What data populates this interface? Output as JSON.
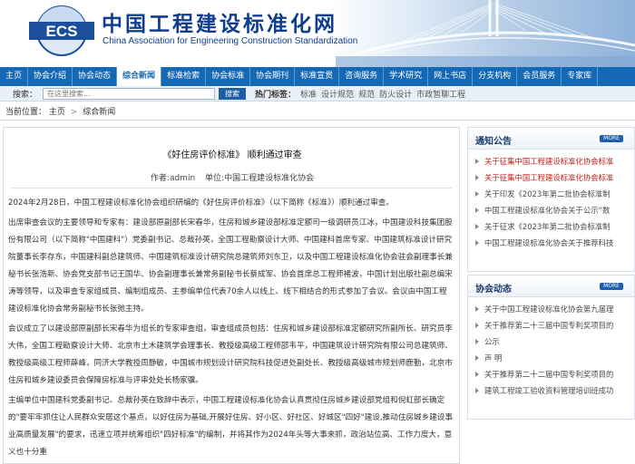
{
  "header": {
    "logo_text": "ECS",
    "title": "中国工程建设标准化网",
    "subtitle": "China Association for Engineering Construction Standardization"
  },
  "nav": {
    "items": [
      "主页",
      "协会介绍",
      "协会动态",
      "综合新闻",
      "标准检索",
      "协会标准",
      "协会期刊",
      "标准宣贯",
      "咨询服务",
      "学术研究",
      "网上书店",
      "分支机构",
      "会员服务",
      "专家库"
    ],
    "active_index": 3
  },
  "search": {
    "label": "搜索：",
    "placeholder": "在这里搜索...",
    "button": "搜索",
    "hot_label": "热门标签：",
    "tags": [
      "标准",
      "设计规范",
      "规范",
      "防火设计",
      "市政暂聊工程"
    ]
  },
  "breadcrumb": {
    "prefix": "当前位置：",
    "items": [
      "主页",
      "综合新闻"
    ],
    "sep": ">"
  },
  "article": {
    "title": "《好住房评价标准》 顺利通过审查",
    "author": "作者:admin",
    "unit": "单位:中国工程建设标准化协会",
    "paragraphs": [
      "2024年2月28日，中国工程建设标准化协会组织研编的《好住房评价标准》（以下简称《标准》）顺利通过审查。",
      "出席审查会议的主要领导和专家有：建设部原副部长宋春华，住房和城乡建设部标准定额司一级调研员江冰，中国建设科技集团股份有限公司（以下简称\"中国建科\"）党委副书记、总裁孙英，全国工程勘察设计大师、中国建科首席专家、中国建筑标准设计研究院董事长李存东，中国建科副总建筑师、中国建筑标准设计研究院总建筑师刘东卫，以及中国工程建设标准化协会驻会副理事长兼秘书长张浩新、协会党支部书记王国华、协会副理事长兼常务副秘书长蔡成军、协会首席总工程师褚波，中国计划出版社副总编宋涛等领导，以及审查专家组成员、编制组成员、主参编单位代表70余人以线上、线下相结合的形式参加了会议。会议由中国工程建设标准化协会常务副秘书长张弛主持。",
      "会议成立了以建设部原副部长宋春华为组长的专家审查组，审查组成员包括：住房和城乡建设部标准定额研究所副所长、研究员李大伟，全国工程勘察设计大师、北京市土木建筑学会理事长、教授级高级工程师邵韦平，中国建筑设计研究院有限公司总建筑师、教授级高级工程师薛峰，同济大学教授周静敏，中国城市规划设计研究院科技促进处副处长、教授级高级城市规划师鹿勤，北京市住房和城乡建设委员会保障房标准与评审处处长杨家骥。",
      "主编单位中国建科党委副书记、总裁孙英在致辞中表示，中国工程建设标准化协会认真贯彻住房城乡建设部党组和倪虹部长确定的\"要牢牢抓住让人民群众安居这个基点，以好住房为基础,开展好住房、好小区、好社区、好城区\"四好\"建设,推动住房城乡建设事业高质量发展\"的要求，迅速立项并统筹组织\"四好标准\"的编制，并将其作为2024年头等大事来抓，政治站位高、工作力度大，意义也十分重"
    ]
  },
  "panels": {
    "notice": {
      "title": "通知公告",
      "more": "MORE",
      "items": [
        {
          "text": "关于征集中国工程建设标准化协会标准",
          "color": "red"
        },
        {
          "text": "关于征集中国工程建设标准化协会标准",
          "color": "red"
        },
        {
          "text": "关于印发《2023年第二批协会标准制",
          "color": "gray"
        },
        {
          "text": "中国工程建设标准化协会关于公示“数",
          "color": "gray"
        },
        {
          "text": "关于征求《2023年第二批协会标准制",
          "color": "gray"
        },
        {
          "text": "中国工程建设标准化协会关于推荐科技",
          "color": "gray"
        }
      ]
    },
    "news": {
      "title": "协会动态",
      "more": "MORE",
      "items": [
        {
          "text": "关于中国工程建设标准化协会第九届理",
          "color": "gray"
        },
        {
          "text": "关于推荐第二十三届中国专利奖项目的",
          "color": "gray"
        },
        {
          "text": "公示",
          "color": "gray"
        },
        {
          "text": "声 明",
          "color": "gray"
        },
        {
          "text": "关于推荐第二十二届中国专利奖项目的",
          "color": "gray"
        },
        {
          "text": "建筑工程竣工验收资料管理培训班成功",
          "color": "gray"
        }
      ]
    }
  },
  "colors": {
    "nav_bg": "#1568b4",
    "title_blue": "#0f3d8f",
    "link_red": "#c8201a"
  }
}
